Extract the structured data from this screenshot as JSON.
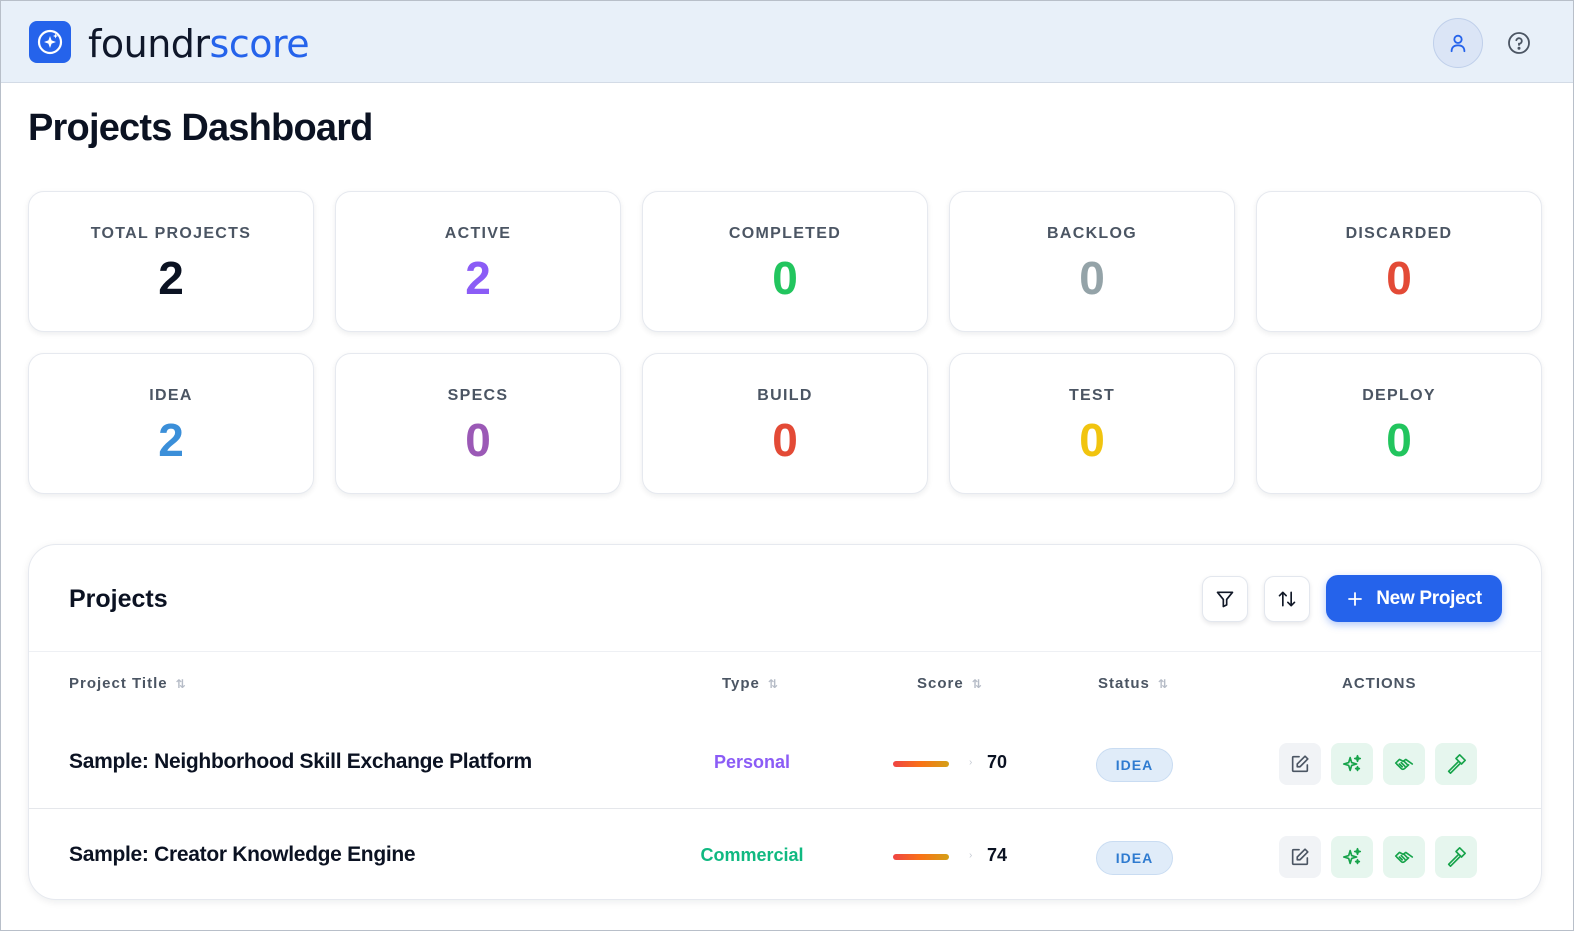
{
  "app": {
    "brand_part1": "foundr",
    "brand_part2": "score",
    "icons": {
      "logo": "sparkle-compass-icon",
      "profile": "user-icon",
      "help": "help-circle-icon"
    }
  },
  "page": {
    "title": "Projects Dashboard"
  },
  "stats": [
    {
      "label": "TOTAL PROJECTS",
      "value": "2",
      "color": "#0b1222"
    },
    {
      "label": "ACTIVE",
      "value": "2",
      "color": "#8b5cf6"
    },
    {
      "label": "COMPLETED",
      "value": "0",
      "color": "#22c55e"
    },
    {
      "label": "BACKLOG",
      "value": "0",
      "color": "#94a3a8"
    },
    {
      "label": "DISCARDED",
      "value": "0",
      "color": "#e34a36"
    },
    {
      "label": "IDEA",
      "value": "2",
      "color": "#3b8fd9"
    },
    {
      "label": "SPECS",
      "value": "0",
      "color": "#9b59b6"
    },
    {
      "label": "BUILD",
      "value": "0",
      "color": "#e34a36"
    },
    {
      "label": "TEST",
      "value": "0",
      "color": "#f1c40f"
    },
    {
      "label": "DEPLOY",
      "value": "0",
      "color": "#22c55e"
    }
  ],
  "projects_panel": {
    "title": "Projects",
    "new_button_label": "New Project",
    "icons": {
      "filter": "filter-icon",
      "sort": "sort-arrows-icon",
      "add": "plus-icon"
    },
    "columns": {
      "title": "Project Title",
      "type": "Type",
      "score": "Score",
      "status": "Status",
      "actions": "ACTIONS"
    },
    "rows": [
      {
        "title": "Sample: Neighborhood Skill Exchange Platform",
        "type": "Personal",
        "type_color": "#8b5cf6",
        "score": "70",
        "status": "IDEA",
        "actions": [
          "edit-icon",
          "sparkles-icon",
          "handshake-icon",
          "hammer-icon"
        ]
      },
      {
        "title": "Sample: Creator Knowledge Engine",
        "type": "Commercial",
        "type_color": "#10b981",
        "score": "74",
        "status": "IDEA",
        "actions": [
          "edit-icon",
          "sparkles-icon",
          "handshake-icon",
          "hammer-icon"
        ]
      }
    ]
  }
}
